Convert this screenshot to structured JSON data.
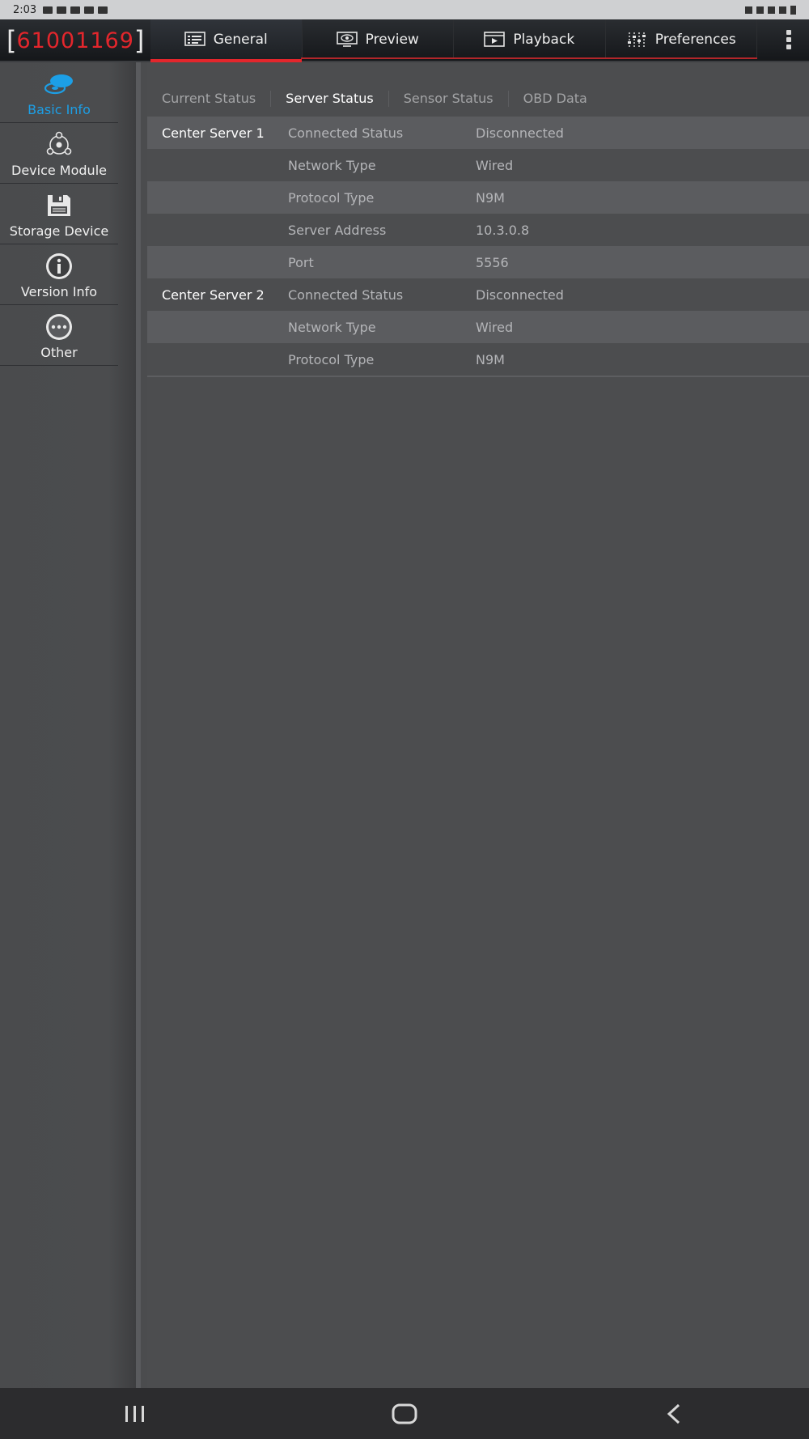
{
  "status_bar": {
    "time": "2:03"
  },
  "header": {
    "device_id": "61001169",
    "tabs": [
      {
        "label": "General",
        "icon": "general-icon",
        "active": true
      },
      {
        "label": "Preview",
        "icon": "preview-icon",
        "active": false
      },
      {
        "label": "Playback",
        "icon": "playback-icon",
        "active": false
      },
      {
        "label": "Preferences",
        "icon": "preferences-icon",
        "active": false
      }
    ]
  },
  "sidebar": {
    "items": [
      {
        "label": "Basic Info",
        "icon": "basic-info-icon",
        "active": true
      },
      {
        "label": "Device Module",
        "icon": "device-module-icon",
        "active": false
      },
      {
        "label": "Storage Device",
        "icon": "storage-device-icon",
        "active": false
      },
      {
        "label": "Version Info",
        "icon": "version-info-icon",
        "active": false
      },
      {
        "label": "Other",
        "icon": "other-icon",
        "active": false
      }
    ]
  },
  "main": {
    "subtabs": [
      {
        "label": "Current Status",
        "active": false
      },
      {
        "label": "Server Status",
        "active": true
      },
      {
        "label": "Sensor Status",
        "active": false
      },
      {
        "label": "OBD Data",
        "active": false
      }
    ],
    "rows": [
      {
        "group": "Center Server 1",
        "key": "Connected Status",
        "value": "Disconnected"
      },
      {
        "group": "",
        "key": "Network Type",
        "value": "Wired"
      },
      {
        "group": "",
        "key": "Protocol Type",
        "value": "N9M"
      },
      {
        "group": "",
        "key": "Server Address",
        "value": "10.3.0.8"
      },
      {
        "group": "",
        "key": "Port",
        "value": "5556"
      },
      {
        "group": "Center Server 2",
        "key": "Connected Status",
        "value": "Disconnected"
      },
      {
        "group": "",
        "key": "Network Type",
        "value": "Wired"
      },
      {
        "group": "",
        "key": "Protocol Type",
        "value": "N9M"
      }
    ]
  },
  "colors": {
    "accent_red": "#e3262c",
    "active_blue": "#1c9fe6",
    "background": "#4c4d4f"
  }
}
